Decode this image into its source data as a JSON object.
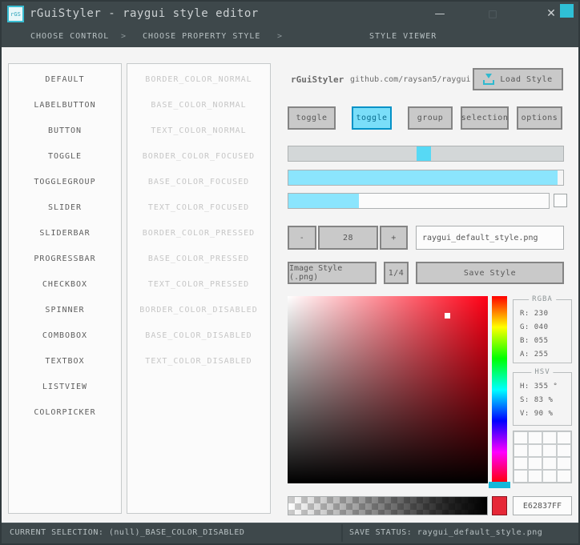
{
  "window": {
    "icon": "rGS",
    "title": "rGuiStyler - raygui style editor",
    "minimize_glyph": "—",
    "maximize_glyph": "□",
    "close_glyph": "✕"
  },
  "breadcrumb": {
    "separator": ">",
    "items": [
      "CHOOSE CONTROL",
      "CHOOSE PROPERTY STYLE",
      "STYLE VIEWER"
    ]
  },
  "controls_list": [
    "DEFAULT",
    "LABELBUTTON",
    "BUTTON",
    "TOGGLE",
    "TOGGLEGROUP",
    "SLIDER",
    "SLIDERBAR",
    "PROGRESSBAR",
    "CHECKBOX",
    "SPINNER",
    "COMBOBOX",
    "TEXTBOX",
    "LISTVIEW",
    "COLORPICKER"
  ],
  "properties_list": [
    "BORDER_COLOR_NORMAL",
    "BASE_COLOR_NORMAL",
    "TEXT_COLOR_NORMAL",
    "BORDER_COLOR_FOCUSED",
    "BASE_COLOR_FOCUSED",
    "TEXT_COLOR_FOCUSED",
    "BORDER_COLOR_PRESSED",
    "BASE_COLOR_PRESSED",
    "TEXT_COLOR_PRESSED",
    "BORDER_COLOR_DISABLED",
    "BASE_COLOR_DISABLED",
    "TEXT_COLOR_DISABLED"
  ],
  "viewer": {
    "brand": "rGuiStyler",
    "repo": "github.com/raysan5/raygui",
    "load_style": "Load Style",
    "toggles": [
      "toggle",
      "toggle",
      "group",
      "selection",
      "options"
    ],
    "active_toggle_index": 1,
    "slider_pct": 47,
    "progress_full_pct": 98,
    "progress_partial_pct": 27,
    "checkbox_checked": false,
    "spinner_minus": "-",
    "spinner_value": "28",
    "spinner_plus": "+",
    "file_name": "raygui_default_style.png",
    "image_style": "Image Style (.png)",
    "ratio": "1/4",
    "save_style": "Save Style",
    "rgba_label": "RGBA",
    "rgba_rows": [
      "R: 230",
      "G: 040",
      "B: 055",
      "A: 255"
    ],
    "hsv_label": "HSV",
    "hsv_rows": [
      "H: 355 °",
      "S: 83 %",
      "V: 90 %"
    ],
    "hex_value": "E62837FF"
  },
  "statusbar": {
    "left": "CURRENT SELECTION: (null)_BASE_COLOR_DISABLED",
    "right": "SAVE STATUS: raygui_default_style.png"
  },
  "colors": {
    "titlebar": "#3E484B",
    "accent_cyan": "#7ADEF9",
    "accent_border": "#0492C7",
    "fill_cyan": "#8BE5FD",
    "hue_handle": "#14B8DA",
    "current_color": "#E62837",
    "picker_base_hue": "#FF0015"
  }
}
